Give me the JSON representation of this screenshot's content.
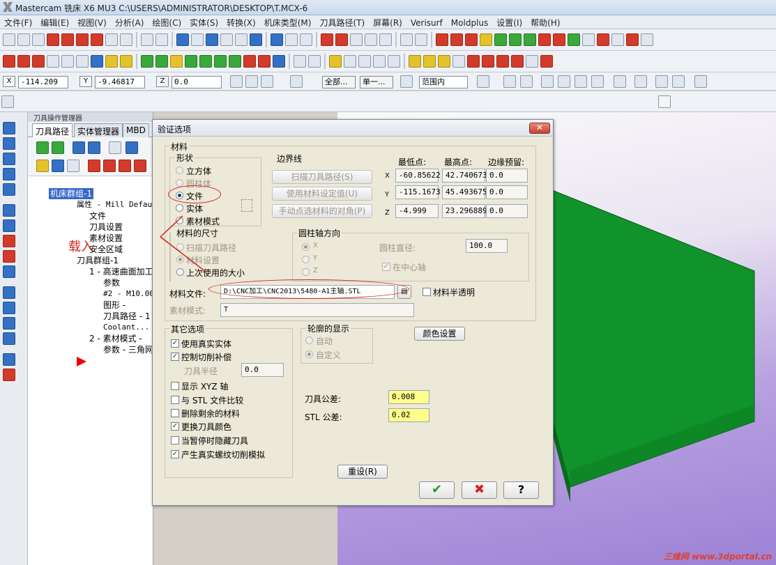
{
  "window": {
    "title": "Mastercam 铣床 X6 MU3  C:\\USERS\\ADMINISTRATOR\\DESKTOP\\T.MCX-6"
  },
  "menu": [
    "文件(F)",
    "编辑(E)",
    "视图(V)",
    "分析(A)",
    "绘图(C)",
    "实体(S)",
    "转换(X)",
    "机床类型(M)",
    "刀具路径(T)",
    "屏幕(R)",
    "Verisurf",
    "Moldplus",
    "设置(I)",
    "帮助(H)"
  ],
  "coords": {
    "x_label": "X",
    "x_value": "-114.209",
    "y_label": "Y",
    "y_value": "-9.46817",
    "z_label": "Z",
    "z_value": "0.0",
    "select_all": "全部...",
    "select_single": "单一...",
    "range": "范围内"
  },
  "manager": {
    "title": "刀具操作管理器",
    "tabs": [
      "刀具路径",
      "实体管理器",
      "MBD"
    ],
    "tree": [
      "机床群组-1",
      "属性 - Mill Defaul",
      "文件",
      "刀具设置",
      "素材设置",
      "安全区域",
      "刀具群组-1",
      "1 - 高速曲面加工",
      "参数",
      "#2 - M10.00",
      "图形 -",
      "刀具路径 - 1",
      "Coolant...",
      "2 - 素材模式 -",
      "参数 - 三角网"
    ],
    "annotation": "载入"
  },
  "dialog": {
    "title": "验证选项",
    "material": {
      "group": "材料",
      "shape_label": "形状",
      "shapes": [
        "立方体",
        "圆柱体",
        "文件",
        "实体",
        "素材模式"
      ],
      "selected_shape": "文件"
    },
    "boundary": {
      "label": "边界线",
      "btn_scan": "扫描刀具路径(S)",
      "btn_use_material": "使用材料设定值(U)",
      "btn_manual": "手动点选材料的对角(P)",
      "col_min": "最低点:",
      "col_max": "最高点:",
      "col_margin": "边缘预留:",
      "rows": [
        {
          "axis": "X",
          "min": "-60.85622",
          "max": "42.740673",
          "margin": "0.0"
        },
        {
          "axis": "Y",
          "min": "-115.1673",
          "max": "45.493675",
          "margin": "0.0"
        },
        {
          "axis": "Z",
          "min": "-4.999",
          "max": "23.296889",
          "margin": "0.0"
        }
      ]
    },
    "size": {
      "label": "材料的尺寸",
      "options": [
        "扫描刀具路径",
        "材料设置",
        "上次使用的大小"
      ]
    },
    "cylinder": {
      "label": "圆柱轴方向",
      "axes": [
        "X",
        "Y",
        "Z"
      ],
      "diameter_label": "圆柱直径:",
      "diameter_value": "100.0",
      "center_label": "在中心轴"
    },
    "file": {
      "label": "材料文件:",
      "value": "D:\\CNC加工\\CNC2013\\5480-A1主轴.STL",
      "translucent": "材料半透明"
    },
    "stock_mode": {
      "label": "素材模式:",
      "value": "T"
    },
    "other": {
      "label": "其它选项",
      "options": [
        {
          "text": "使用真实实体",
          "checked": true
        },
        {
          "text": "控制切削补偿",
          "checked": true
        }
      ],
      "radius_label": "刀具半径",
      "radius_value": "0.0",
      "options2": [
        {
          "text": "显示 XYZ 轴",
          "checked": false
        },
        {
          "text": "与 STL 文件比较",
          "checked": false
        },
        {
          "text": "删除剩余的材料",
          "checked": false
        },
        {
          "text": "更换刀具颜色",
          "checked": true
        },
        {
          "text": "当暂停时隐藏刀具",
          "checked": false
        },
        {
          "text": "产生真实螺纹切削模拟",
          "checked": true
        }
      ]
    },
    "outline": {
      "label": "轮廓的显示",
      "auto": "自动",
      "custom": "自定义"
    },
    "color_btn": "颜色设置",
    "tol": {
      "tool_label": "刀具公差:",
      "tool_value": "0.008",
      "stl_label": "STL 公差:",
      "stl_value": "0.02"
    },
    "reset": "重设(R)"
  },
  "watermark": "三维网 www.3dportal.cn",
  "colors": {
    "part_green": "#0f8a27",
    "dialog_bg": "#ece9d8",
    "tol_bg": "#fffd8c",
    "close_red": "#c4432e"
  }
}
